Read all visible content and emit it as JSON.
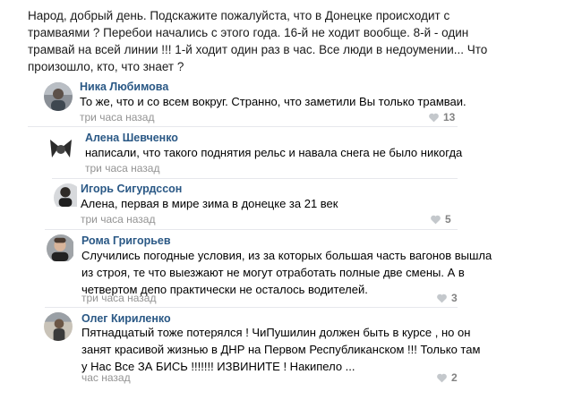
{
  "post": {
    "text": "Народ, добрый день. Подскажите пожалуйста, что в Донецке происходит с\nтрамваями ? Перебои начались с этого года. 16-й не ходит вообще. 8-й - один\nтрамвай на всей линии !!! 1-й ходит один раз в час. Все люди в недоумении... Что\nпроизошло, кто, что знает ?"
  },
  "comments": [
    {
      "author": "Ника Любимова",
      "text": "То же, что и со всем вокруг. Странно, что заметили Вы только трамваи.",
      "time": "три часа назад",
      "likes": "13",
      "avatar_icon": "user-photo-icon"
    },
    {
      "author": "Алена Шевченко",
      "text": "написали, что такого поднятия рельс и навала снега не было никогда",
      "time": "три часа назад",
      "likes": "",
      "avatar_icon": "user-photo-icon"
    },
    {
      "author": "Игорь Сигурдссон",
      "text": "Алена, первая в мире зима в донецке за 21 век",
      "time": "три часа назад",
      "likes": "5",
      "avatar_icon": "user-photo-icon"
    },
    {
      "author": "Рома Григорьев",
      "text": "Случились погодные условия, из за которых большая часть вагонов вышла\nиз строя, те что выезжают не могут отработать полные две смены. А в\nчетвертом депо практически не осталось водителей.",
      "time": "три часа назад",
      "likes": "3",
      "avatar_icon": "user-photo-icon"
    },
    {
      "author": "Олег Кириленко",
      "text": "Пятнадцатый тоже потерялся ! ЧиПушилин должен быть в курсе , но он\nзанят красивой жизнью в ДНР на Первом Республиканском !!! Только там\nу Нас Все ЗА  БИСЬ !!!!!!! ИЗВИНИТЕ ! Накипело ...",
      "time": "час назад",
      "likes": "2",
      "avatar_icon": "user-photo-icon"
    }
  ],
  "colors": {
    "author": "#2a5885",
    "time": "#939393",
    "likes": "#828282",
    "divider": "#e7e8ec"
  },
  "icons": {
    "like": "heart-icon"
  }
}
